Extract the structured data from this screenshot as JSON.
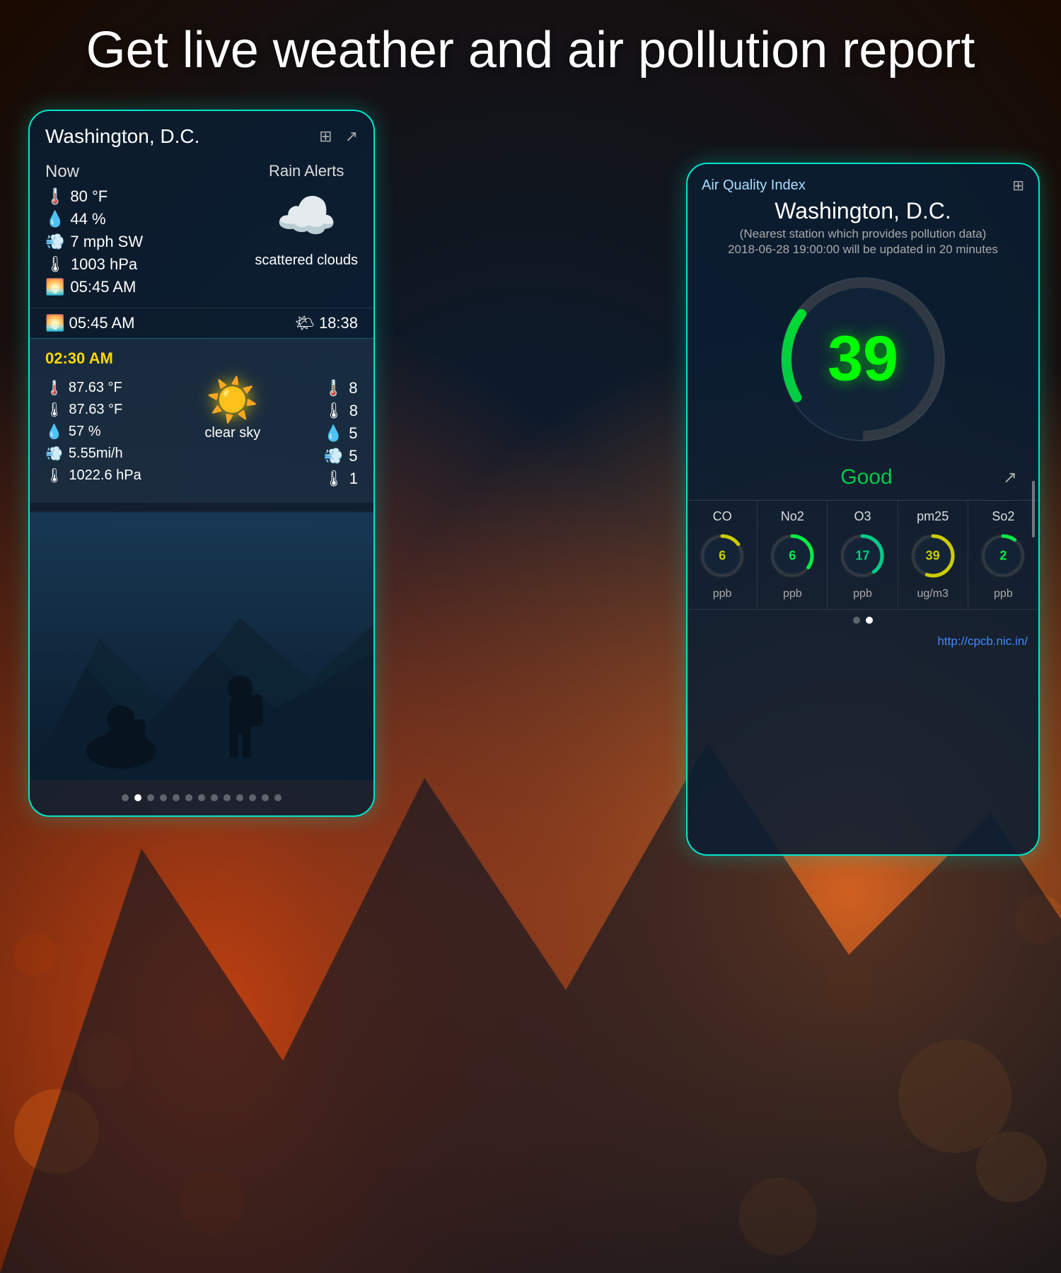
{
  "page": {
    "title": "Get live weather and air pollution report",
    "bg_gradient": "#1a0a00"
  },
  "weather_card": {
    "city": "Washington, D.C.",
    "now_label": "Now",
    "rain_alerts": "Rain Alerts",
    "temperature": "80 °F",
    "humidity": "44 %",
    "wind": "7 mph SW",
    "pressure": "1003 hPa",
    "sunrise": "05:45 AM",
    "sunset": "18:38",
    "condition": "scattered clouds",
    "forecast": {
      "time": "02:30 AM",
      "temp_high": "87.63 °F",
      "temp_low": "87.63 °F",
      "humidity": "57 %",
      "wind": "5.55mi/h",
      "pressure": "1022.6 hPa",
      "temp_high_right": "8",
      "temp_low_right": "8",
      "humidity_right": "5",
      "wind_right": "5",
      "pressure_right": "1",
      "condition": "clear sky"
    },
    "dots": [
      0,
      1,
      2,
      3,
      4,
      5,
      6,
      7,
      8,
      9,
      10,
      11,
      12
    ],
    "active_dot": 1
  },
  "aqi_card": {
    "header": "Air Quality Index",
    "city": "Washington, D.C.",
    "station_note": "(Nearest station which provides pollution data)",
    "date_note": "2018-06-28 19:00:00 will be updated in 20 minutes",
    "aqi_value": "39",
    "aqi_status": "Good",
    "link": "http://cpcb.nic.in/",
    "pollutants": [
      {
        "name": "CO",
        "value": "6",
        "unit": "ppb",
        "color": "#cccc00",
        "arc_pct": 0.15
      },
      {
        "name": "No2",
        "value": "6",
        "unit": "ppb",
        "color": "#00ee44",
        "arc_pct": 0.35
      },
      {
        "name": "O3",
        "value": "17",
        "unit": "ppb",
        "color": "#00cc88",
        "arc_pct": 0.4
      },
      {
        "name": "pm25",
        "value": "39",
        "unit": "ug/m3",
        "color": "#cccc00",
        "arc_pct": 0.55
      },
      {
        "name": "So2",
        "value": "2",
        "unit": "ppb",
        "color": "#00ee44",
        "arc_pct": 0.1
      }
    ],
    "gauge_arc_pct": 0.22,
    "gauge_color": "#00ff00"
  }
}
